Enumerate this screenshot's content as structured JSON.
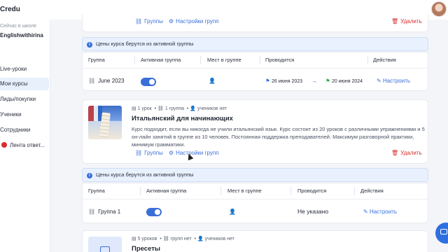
{
  "app": {
    "logo": "Credu"
  },
  "sidebar": {
    "school_label": "Сейчас в школе",
    "school_name": "Englishwithirina",
    "items": [
      {
        "label": "Live-уроки"
      },
      {
        "label": "Мои курсы",
        "active": true
      },
      {
        "label": "Лиды/покупки"
      },
      {
        "label": "Ученики"
      },
      {
        "label": "Сотрудники"
      },
      {
        "label": "Лента ответ..."
      }
    ]
  },
  "actions": {
    "groups": "Группы",
    "group_settings": "Настройки групп",
    "delete": "Удалить",
    "configure": "Настроить"
  },
  "notice_text": "Цены курса берутся из активной группы",
  "table_headers": {
    "group": "Группа",
    "active_group": "Активная группа",
    "seats": "Мест в группе",
    "held": "Проводится",
    "actions": "Действия"
  },
  "course1_group": {
    "name": "June 2023",
    "active": true,
    "start": "26 июня 2023",
    "end": "20 июня 2024",
    "action": "Настроить"
  },
  "course2": {
    "meta_lessons": "1 урок",
    "meta_groups": "1 группа",
    "meta_students": "учеников нет",
    "title": "Итальянский для начинающих",
    "description": "Курс подходит, если вы никогда не учили итальянский язык. Курс состоит из 20 уроков с различными упражнениями и 5 он-лайн занятий в группе из 10 человек. Постоянная поддержка преподавателей. Максимум разговорной практики, минимум грамматики.",
    "group": {
      "name": "Группа 1",
      "active": true,
      "held": "Не указано",
      "action": "Настроить"
    }
  },
  "course3": {
    "meta_lessons": "5 уроков",
    "meta_groups": "групп нет",
    "meta_students": "учеников нет",
    "title": "Пресеты"
  },
  "colors": {
    "accent": "#3b6fd8",
    "danger": "#d92d2d",
    "notice_bg": "#e8f1fd"
  }
}
